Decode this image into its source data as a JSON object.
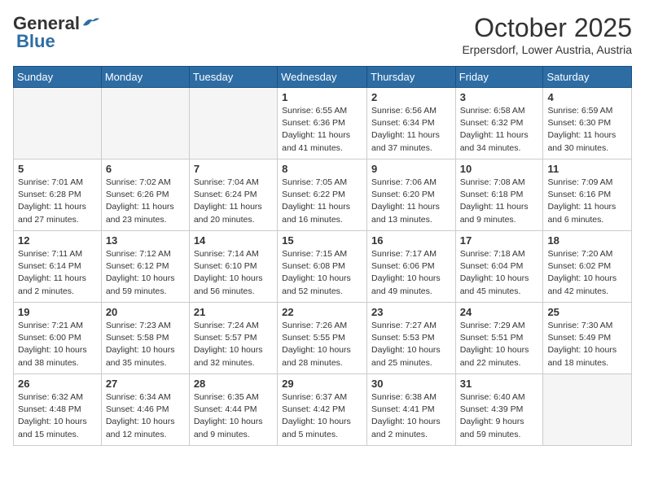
{
  "header": {
    "logo_line1": "General",
    "logo_line2": "Blue",
    "month": "October 2025",
    "location": "Erpersdorf, Lower Austria, Austria"
  },
  "days_of_week": [
    "Sunday",
    "Monday",
    "Tuesday",
    "Wednesday",
    "Thursday",
    "Friday",
    "Saturday"
  ],
  "weeks": [
    [
      {
        "day": "",
        "info": ""
      },
      {
        "day": "",
        "info": ""
      },
      {
        "day": "",
        "info": ""
      },
      {
        "day": "1",
        "info": "Sunrise: 6:55 AM\nSunset: 6:36 PM\nDaylight: 11 hours\nand 41 minutes."
      },
      {
        "day": "2",
        "info": "Sunrise: 6:56 AM\nSunset: 6:34 PM\nDaylight: 11 hours\nand 37 minutes."
      },
      {
        "day": "3",
        "info": "Sunrise: 6:58 AM\nSunset: 6:32 PM\nDaylight: 11 hours\nand 34 minutes."
      },
      {
        "day": "4",
        "info": "Sunrise: 6:59 AM\nSunset: 6:30 PM\nDaylight: 11 hours\nand 30 minutes."
      }
    ],
    [
      {
        "day": "5",
        "info": "Sunrise: 7:01 AM\nSunset: 6:28 PM\nDaylight: 11 hours\nand 27 minutes."
      },
      {
        "day": "6",
        "info": "Sunrise: 7:02 AM\nSunset: 6:26 PM\nDaylight: 11 hours\nand 23 minutes."
      },
      {
        "day": "7",
        "info": "Sunrise: 7:04 AM\nSunset: 6:24 PM\nDaylight: 11 hours\nand 20 minutes."
      },
      {
        "day": "8",
        "info": "Sunrise: 7:05 AM\nSunset: 6:22 PM\nDaylight: 11 hours\nand 16 minutes."
      },
      {
        "day": "9",
        "info": "Sunrise: 7:06 AM\nSunset: 6:20 PM\nDaylight: 11 hours\nand 13 minutes."
      },
      {
        "day": "10",
        "info": "Sunrise: 7:08 AM\nSunset: 6:18 PM\nDaylight: 11 hours\nand 9 minutes."
      },
      {
        "day": "11",
        "info": "Sunrise: 7:09 AM\nSunset: 6:16 PM\nDaylight: 11 hours\nand 6 minutes."
      }
    ],
    [
      {
        "day": "12",
        "info": "Sunrise: 7:11 AM\nSunset: 6:14 PM\nDaylight: 11 hours\nand 2 minutes."
      },
      {
        "day": "13",
        "info": "Sunrise: 7:12 AM\nSunset: 6:12 PM\nDaylight: 10 hours\nand 59 minutes."
      },
      {
        "day": "14",
        "info": "Sunrise: 7:14 AM\nSunset: 6:10 PM\nDaylight: 10 hours\nand 56 minutes."
      },
      {
        "day": "15",
        "info": "Sunrise: 7:15 AM\nSunset: 6:08 PM\nDaylight: 10 hours\nand 52 minutes."
      },
      {
        "day": "16",
        "info": "Sunrise: 7:17 AM\nSunset: 6:06 PM\nDaylight: 10 hours\nand 49 minutes."
      },
      {
        "day": "17",
        "info": "Sunrise: 7:18 AM\nSunset: 6:04 PM\nDaylight: 10 hours\nand 45 minutes."
      },
      {
        "day": "18",
        "info": "Sunrise: 7:20 AM\nSunset: 6:02 PM\nDaylight: 10 hours\nand 42 minutes."
      }
    ],
    [
      {
        "day": "19",
        "info": "Sunrise: 7:21 AM\nSunset: 6:00 PM\nDaylight: 10 hours\nand 38 minutes."
      },
      {
        "day": "20",
        "info": "Sunrise: 7:23 AM\nSunset: 5:58 PM\nDaylight: 10 hours\nand 35 minutes."
      },
      {
        "day": "21",
        "info": "Sunrise: 7:24 AM\nSunset: 5:57 PM\nDaylight: 10 hours\nand 32 minutes."
      },
      {
        "day": "22",
        "info": "Sunrise: 7:26 AM\nSunset: 5:55 PM\nDaylight: 10 hours\nand 28 minutes."
      },
      {
        "day": "23",
        "info": "Sunrise: 7:27 AM\nSunset: 5:53 PM\nDaylight: 10 hours\nand 25 minutes."
      },
      {
        "day": "24",
        "info": "Sunrise: 7:29 AM\nSunset: 5:51 PM\nDaylight: 10 hours\nand 22 minutes."
      },
      {
        "day": "25",
        "info": "Sunrise: 7:30 AM\nSunset: 5:49 PM\nDaylight: 10 hours\nand 18 minutes."
      }
    ],
    [
      {
        "day": "26",
        "info": "Sunrise: 6:32 AM\nSunset: 4:48 PM\nDaylight: 10 hours\nand 15 minutes."
      },
      {
        "day": "27",
        "info": "Sunrise: 6:34 AM\nSunset: 4:46 PM\nDaylight: 10 hours\nand 12 minutes."
      },
      {
        "day": "28",
        "info": "Sunrise: 6:35 AM\nSunset: 4:44 PM\nDaylight: 10 hours\nand 9 minutes."
      },
      {
        "day": "29",
        "info": "Sunrise: 6:37 AM\nSunset: 4:42 PM\nDaylight: 10 hours\nand 5 minutes."
      },
      {
        "day": "30",
        "info": "Sunrise: 6:38 AM\nSunset: 4:41 PM\nDaylight: 10 hours\nand 2 minutes."
      },
      {
        "day": "31",
        "info": "Sunrise: 6:40 AM\nSunset: 4:39 PM\nDaylight: 9 hours\nand 59 minutes."
      },
      {
        "day": "",
        "info": ""
      }
    ]
  ]
}
